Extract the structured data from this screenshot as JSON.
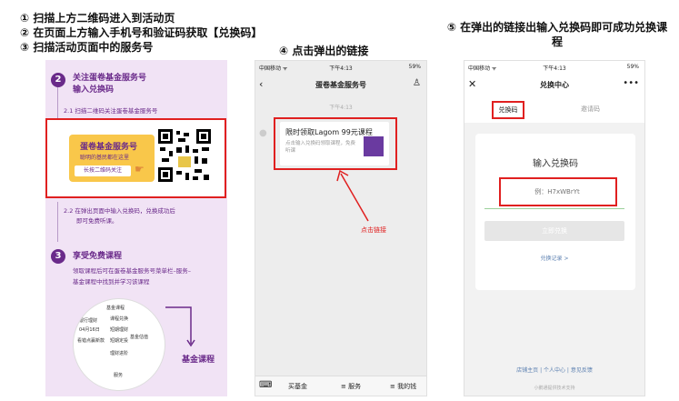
{
  "instructions": {
    "step1": "① 扫描上方二维码进入到活动页",
    "step2": "② 在页面上方输入手机号和验证码获取【兑换码】",
    "step3": "③ 扫描活动页面中的服务号",
    "step4": "④ 点击弹出的链接",
    "step5": "⑤ 在弹出的链接出输入兑换码即可成功兑换课程"
  },
  "panel1": {
    "step2_num": "2",
    "step2_title_line1": "关注蛋卷基金服务号",
    "step2_title_line2": "输入兑换码",
    "sub21": "2.1 扫描二维码关注蛋卷基金服务号",
    "card_title": "蛋卷基金服务号",
    "card_subtitle": "聪明的基民都在这里",
    "card_button": "长按二维码关注",
    "sub22_line1": "2.2 在弹出页面中输入兑换码，兑换成功后",
    "sub22_line2": "即可免费听课。",
    "step3_num": "3",
    "step3_title": "享受免费课程",
    "step3_desc_line1": "领取课程后可在蛋卷基金服务号菜单栏–服务–",
    "step3_desc_line2": "基金课程中找到并学习该课程",
    "menu_items": [
      "基金课程",
      "课程兑换",
      "短期理财",
      "短期定投",
      "基金估值",
      "理财进阶",
      "服务"
    ],
    "menu_left": [
      "04月16日",
      "看错点赢新款",
      "银行理财"
    ],
    "fund_course_label": "基金课程"
  },
  "panel2": {
    "carrier": "中国移动 ᯤ",
    "clock": "下午4:13",
    "battery": "59%",
    "title": "蛋卷基金服务号",
    "time": "下午4:13",
    "msg_title": "限时领取Lagom 99元课程",
    "msg_desc": "点击输入兑换码领取课程，免费听课",
    "click_label": "点击链接",
    "tabs": [
      "买基金",
      "≡ 服务",
      "≡ 我的钱"
    ]
  },
  "panel3": {
    "carrier": "中国移动 ᯤ",
    "clock": "下午4:13",
    "battery": "59%",
    "title": "兑换中心",
    "tab_redeem": "兑换码",
    "tab_invite": "邀请码",
    "heading": "输入兑换码",
    "input_placeholder": "例：H7xWBrYt",
    "button": "立即兑换",
    "record_link": "兑换记录 >",
    "footer_links": "店铺主页 | 个人中心 | 意见反馈",
    "footnote": "小鹅通提供技术支持"
  },
  "colors": {
    "accent_red": "#e02020",
    "brand_purple": "#6a2a8a",
    "panel_purple_bg": "#f1e3f5"
  }
}
